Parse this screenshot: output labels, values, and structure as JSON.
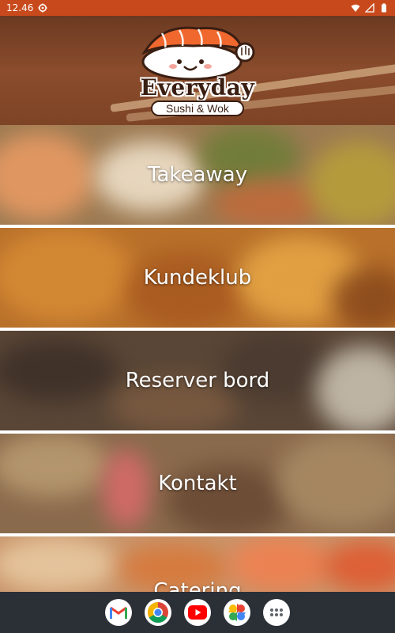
{
  "status_bar": {
    "time": "12.46",
    "icons": [
      "settings-gear-icon",
      "wifi-icon",
      "signal-icon",
      "battery-icon"
    ]
  },
  "header": {
    "logo_name": "Everyday",
    "logo_sub": "Sushi & Wok"
  },
  "menu": {
    "items": [
      {
        "label": "Takeaway"
      },
      {
        "label": "Kundeklub"
      },
      {
        "label": "Reserver bord"
      },
      {
        "label": "Kontakt"
      },
      {
        "label": "Catering"
      }
    ]
  },
  "dock": {
    "apps": [
      "gmail-icon",
      "chrome-icon",
      "youtube-icon",
      "photos-icon",
      "app-drawer-icon"
    ]
  },
  "colors": {
    "status_bar": "#c84a1c",
    "header_wood": "#7e4426",
    "nav_bar": "#2b2f36"
  }
}
